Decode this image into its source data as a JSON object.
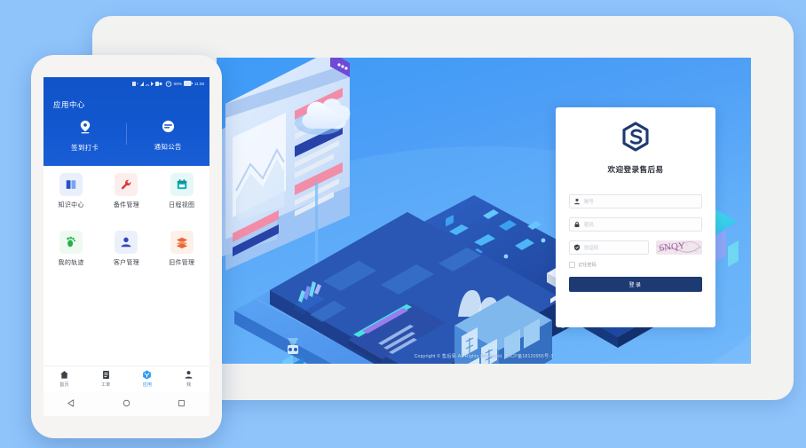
{
  "background_color": "#8fc4fb",
  "tablet": {
    "name": "tablet-device",
    "screen": {
      "brand_color": "#2f8ef4",
      "copyright": "Copyright © 售后易 All Rights Reserved.  粤ICP备18120955号-3"
    },
    "login": {
      "logo_name": "hexagon-s-logo",
      "logo_color": "#1e3a73",
      "title": "欢迎登录售后易",
      "fields": [
        {
          "icon": "user-icon",
          "placeholder": "账号",
          "value": ""
        },
        {
          "icon": "lock-icon",
          "placeholder": "密码",
          "value": ""
        },
        {
          "icon": "shield-icon",
          "placeholder": "验证码",
          "value": ""
        }
      ],
      "captcha_text": "6NQY",
      "remember_label": "记住密码",
      "remember_checked": false,
      "submit_label": "登录",
      "submit_color": "#1e3a73"
    }
  },
  "phone": {
    "name": "phone-device",
    "status_bar": {
      "battery": "68%",
      "time": "11:08",
      "icons": [
        "sim-icon",
        "signal-icon",
        "wifi-icon",
        "bluetooth-icon",
        "alarm-icon",
        "battery-icon"
      ]
    },
    "header": {
      "title": "应用中心",
      "color": "#1154c8",
      "quick_actions": [
        {
          "icon": "location-pin-icon",
          "label": "签到打卡"
        },
        {
          "icon": "message-bubble-icon",
          "label": "通知公告"
        }
      ]
    },
    "app_grid": [
      {
        "icon": "book-icon",
        "label": "知识中心",
        "bg": "#eaf0fb",
        "fg": "#2354c7"
      },
      {
        "icon": "wrench-icon",
        "label": "备件管理",
        "bg": "#fdeeee",
        "fg": "#d63a3a"
      },
      {
        "icon": "calendar-icon",
        "label": "日程视图",
        "bg": "#e6f7f7",
        "fg": "#16b3b8"
      },
      {
        "icon": "footprint-icon",
        "label": "我的轨迹",
        "bg": "#eefaf0",
        "fg": "#22b14c"
      },
      {
        "icon": "person-icon",
        "label": "客户管理",
        "bg": "#ecf0fb",
        "fg": "#2f47b8"
      },
      {
        "icon": "layers-icon",
        "label": "旧件管理",
        "bg": "#fdf0e8",
        "fg": "#e8653a"
      }
    ],
    "tab_bar": {
      "active_index": 2,
      "active_color": "#2f9bf5",
      "items": [
        {
          "icon": "home-icon",
          "label": "首页"
        },
        {
          "icon": "order-icon",
          "label": "工单"
        },
        {
          "icon": "apps-icon",
          "label": "应用"
        },
        {
          "icon": "user-icon",
          "label": "我"
        }
      ]
    },
    "system_nav": [
      {
        "icon": "back-triangle-icon",
        "label": ""
      },
      {
        "icon": "home-circle-icon",
        "label": ""
      },
      {
        "icon": "recents-square-icon",
        "label": ""
      }
    ]
  }
}
